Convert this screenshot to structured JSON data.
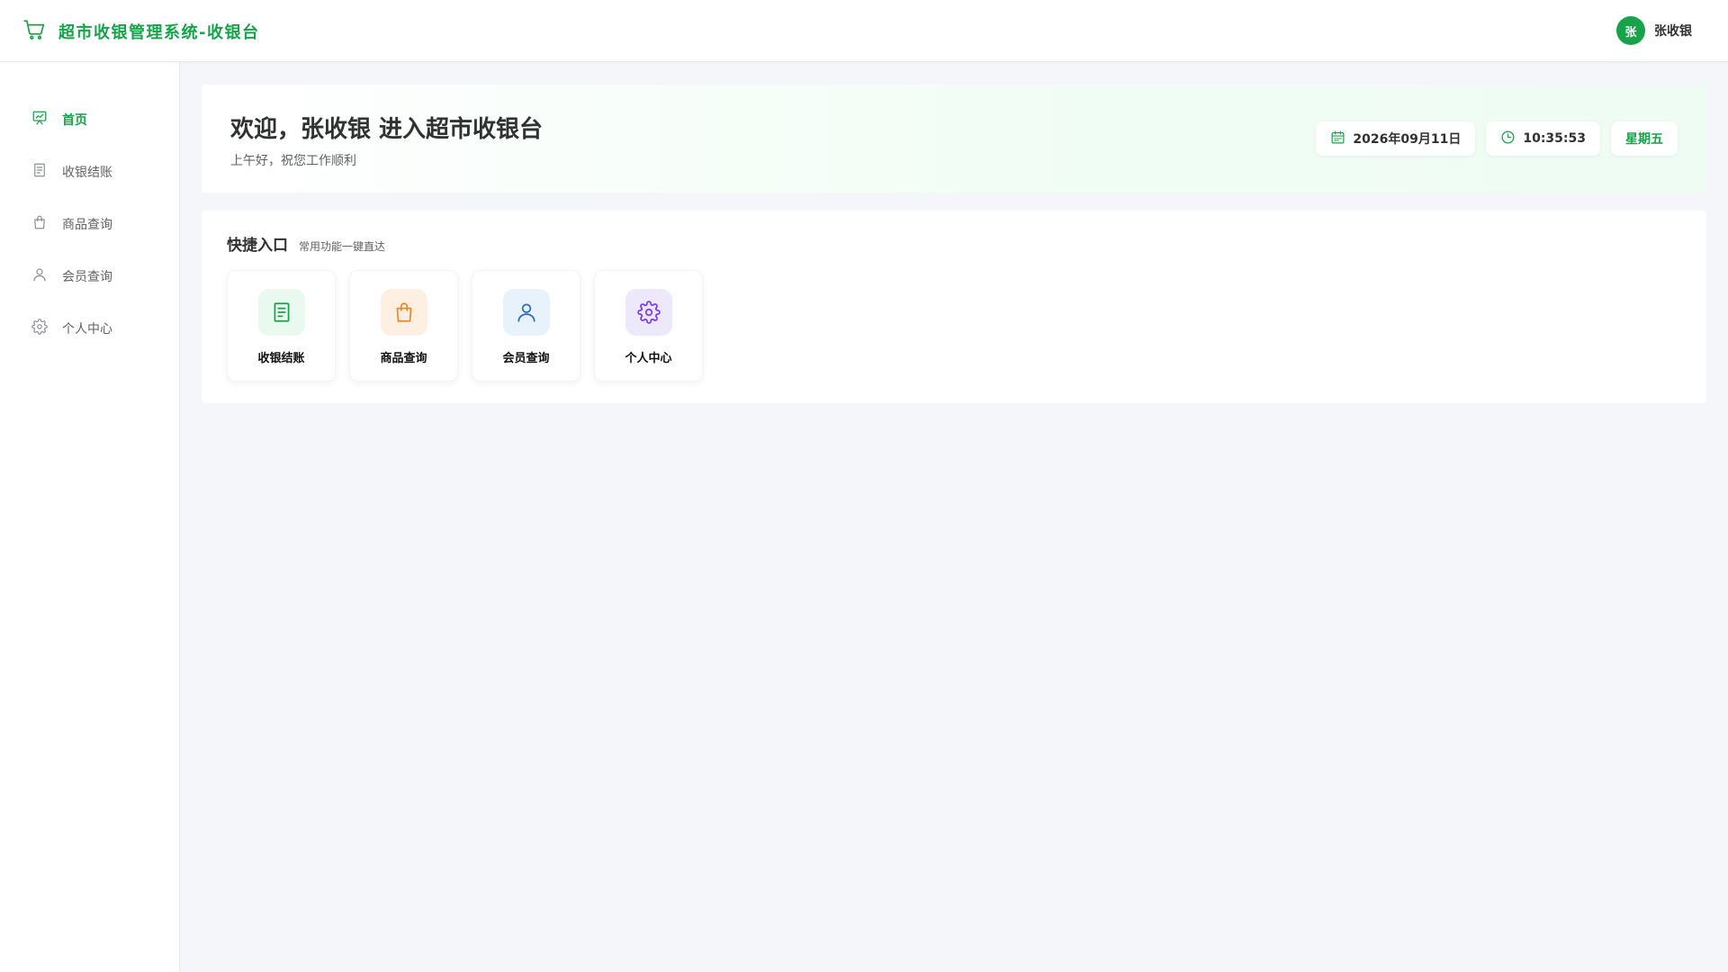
{
  "header": {
    "title": "超市收银管理系统-收银台",
    "user": {
      "avatar_text": "张",
      "name": "张收银"
    }
  },
  "sidebar": {
    "items": [
      {
        "label": "首页",
        "icon": "dashboard-icon",
        "active": true
      },
      {
        "label": "收银结账",
        "icon": "receipt-icon",
        "active": false
      },
      {
        "label": "商品查询",
        "icon": "shopping-bag-icon",
        "active": false
      },
      {
        "label": "会员查询",
        "icon": "user-icon",
        "active": false
      },
      {
        "label": "个人中心",
        "icon": "gear-icon",
        "active": false
      }
    ]
  },
  "welcome": {
    "title": "欢迎，张收银 进入超市收银台",
    "subtitle": "上午好，祝您工作顺利",
    "date": "2026年09月11日",
    "time": "10:35:53",
    "weekday": "星期五"
  },
  "quick": {
    "title": "快捷入口",
    "subtitle": "常用功能一键直达",
    "items": [
      {
        "label": "收银结账",
        "icon": "receipt-icon",
        "color": "#16a34a",
        "bg": "#e9f9ef"
      },
      {
        "label": "商品查询",
        "icon": "shopping-bag-icon",
        "color": "#ea8a2a",
        "bg": "#fdf0e2"
      },
      {
        "label": "会员查询",
        "icon": "user-icon",
        "color": "#2b6cb0",
        "bg": "#e8f2fb"
      },
      {
        "label": "个人中心",
        "icon": "gear-icon",
        "color": "#7c3aed",
        "bg": "#eee8fb"
      }
    ]
  },
  "colors": {
    "accent": "#16a34a",
    "text": "#303133",
    "muted": "#606266"
  }
}
